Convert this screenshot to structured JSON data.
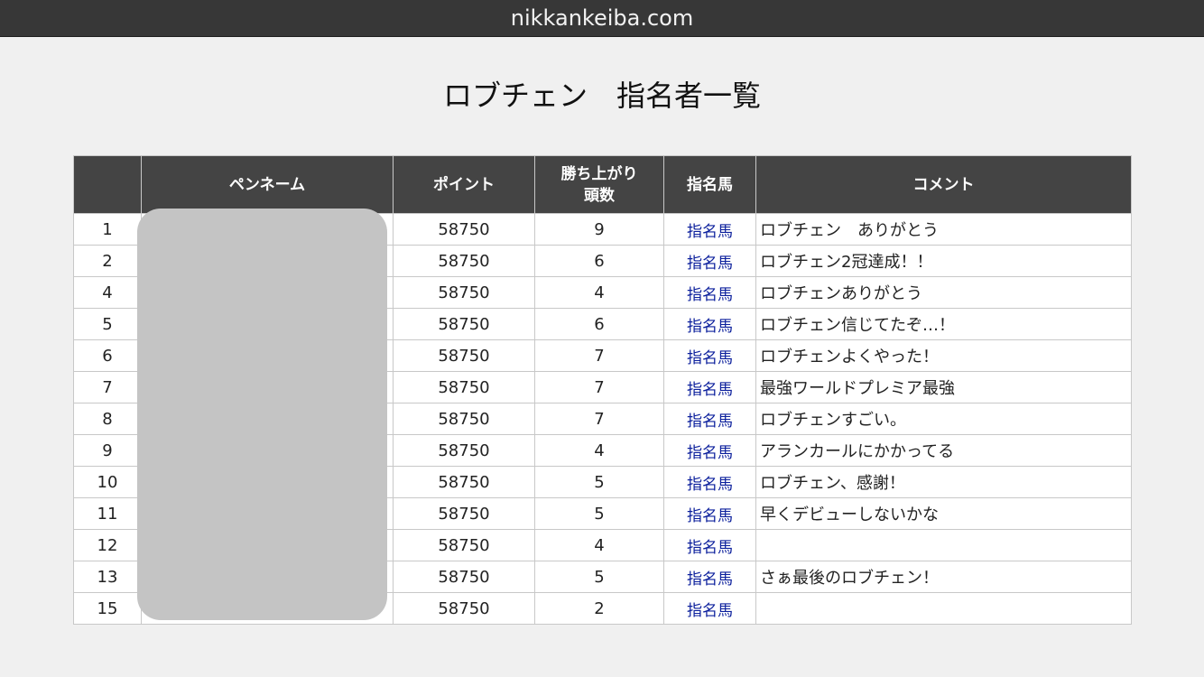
{
  "browser": {
    "url": "nikkankeiba.com"
  },
  "page": {
    "title": "ロブチェン　指名者一覧"
  },
  "table": {
    "headers": {
      "rank": "",
      "penname": "ペンネーム",
      "points": "ポイント",
      "winners_line1": "勝ち上がり",
      "winners_line2": "頭数",
      "horse": "指名馬",
      "comment": "コメント"
    },
    "rows": [
      {
        "rank": "1",
        "points": "58750",
        "winners": "9",
        "horse": "指名馬",
        "comment": "ロブチェン　ありがとう"
      },
      {
        "rank": "2",
        "points": "58750",
        "winners": "6",
        "horse": "指名馬",
        "comment": "ロブチェン2冠達成！！"
      },
      {
        "rank": "4",
        "points": "58750",
        "winners": "4",
        "horse": "指名馬",
        "comment": "ロブチェンありがとう"
      },
      {
        "rank": "5",
        "points": "58750",
        "winners": "6",
        "horse": "指名馬",
        "comment": "ロブチェン信じてたぞ…！"
      },
      {
        "rank": "6",
        "points": "58750",
        "winners": "7",
        "horse": "指名馬",
        "comment": "ロブチェンよくやった！"
      },
      {
        "rank": "7",
        "points": "58750",
        "winners": "7",
        "horse": "指名馬",
        "comment": "最強ワールドプレミア最強"
      },
      {
        "rank": "8",
        "points": "58750",
        "winners": "7",
        "horse": "指名馬",
        "comment": "ロブチェンすごい。"
      },
      {
        "rank": "9",
        "points": "58750",
        "winners": "4",
        "horse": "指名馬",
        "comment": "アランカールにかかってる"
      },
      {
        "rank": "10",
        "points": "58750",
        "winners": "5",
        "horse": "指名馬",
        "comment": "ロブチェン、感謝！"
      },
      {
        "rank": "11",
        "points": "58750",
        "winners": "5",
        "horse": "指名馬",
        "comment": "早くデビューしないかな"
      },
      {
        "rank": "12",
        "points": "58750",
        "winners": "4",
        "horse": "指名馬",
        "comment": ""
      },
      {
        "rank": "13",
        "points": "58750",
        "winners": "5",
        "horse": "指名馬",
        "comment": "さぁ最後のロブチェン！"
      },
      {
        "rank": "15",
        "points": "58750",
        "winners": "2",
        "horse": "指名馬",
        "comment": ""
      }
    ]
  }
}
